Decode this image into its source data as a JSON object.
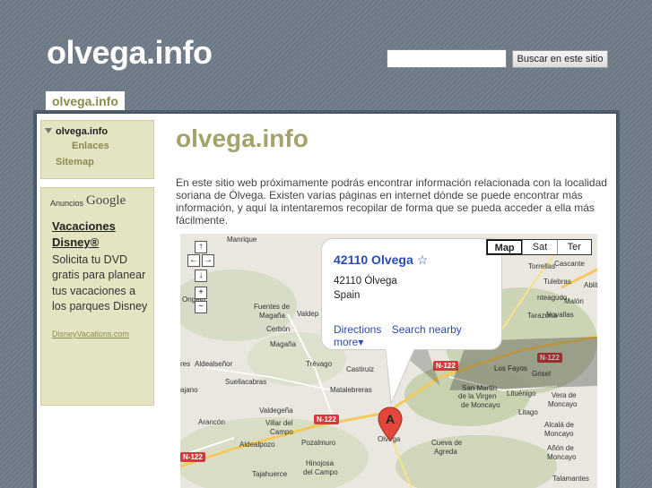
{
  "header": {
    "site_title": "olvega.info",
    "search_placeholder": "",
    "search_button": "Buscar en este sitio"
  },
  "tab": {
    "label": "olvega.info"
  },
  "sidebar": {
    "nav": [
      {
        "label": "olvega.info",
        "active": true
      },
      {
        "label": "Enlaces"
      },
      {
        "label": "Sitemap"
      }
    ],
    "ad": {
      "ads_label": "Anuncios",
      "google_label": "Google",
      "title": "Vacaciones Disney®",
      "body": "Solicita tu DVD gratis para planear tus vacaciones a los parques Disney",
      "url": "DisneyVacations.com"
    }
  },
  "main": {
    "title": "olvega.info",
    "intro": "En este sitio web próximamente podrás encontrar información relacionada con la localidad soriana de Ólvega. Existen varias páginas en internet dónde se puede encontrar más información, y aquí la intentaremos recopilar de forma que se pueda acceder a ella más fácilmente."
  },
  "map": {
    "type_buttons": [
      "Map",
      "Sat",
      "Ter"
    ],
    "info_window": {
      "title": "42110 Olvega",
      "line1": "42110 Ólvega",
      "line2": "Spain",
      "links": [
        "Directions",
        "Search nearby",
        "more▾"
      ]
    },
    "marker_label": "A",
    "places": [
      {
        "name": "Manrique"
      },
      {
        "name": "Fuentes de"
      },
      {
        "name": "Magaña"
      },
      {
        "name": "Valdep"
      },
      {
        "name": "Cerbón"
      },
      {
        "name": "Magaña"
      },
      {
        "name": "Aldealseñor"
      },
      {
        "name": "Suellacabras"
      },
      {
        "name": "Trévago"
      },
      {
        "name": "Castiruiz"
      },
      {
        "name": "Matalebreras"
      },
      {
        "name": "Valdegeña"
      },
      {
        "name": "Arancón"
      },
      {
        "name": "Villar del"
      },
      {
        "name": "Campo"
      },
      {
        "name": "Aldealpozo"
      },
      {
        "name": "Pozalmuro"
      },
      {
        "name": "Hinojosa"
      },
      {
        "name": "del Campo"
      },
      {
        "name": "Tajahuerce"
      },
      {
        "name": "Olvega"
      },
      {
        "name": "Cueva de"
      },
      {
        "name": "Agreda"
      },
      {
        "name": "San Martín"
      },
      {
        "name": "de la Virgen"
      },
      {
        "name": "de Moncayo"
      },
      {
        "name": "Litago"
      },
      {
        "name": "Lituénigo"
      },
      {
        "name": "Vera de"
      },
      {
        "name": "Moncayo"
      },
      {
        "name": "Alcalá de"
      },
      {
        "name": "Moncayo"
      },
      {
        "name": "Añón de"
      },
      {
        "name": "Moncayo"
      },
      {
        "name": "Talamantes"
      },
      {
        "name": "Tarazona"
      },
      {
        "name": "Los Fayos"
      },
      {
        "name": "Grisel"
      },
      {
        "name": "Torrellas"
      },
      {
        "name": "Novallas"
      },
      {
        "name": "Malón"
      },
      {
        "name": "nteagudo"
      },
      {
        "name": "Tulebras"
      },
      {
        "name": "Ablit"
      },
      {
        "name": "Cascante"
      },
      {
        "name": "Ongelo"
      },
      {
        "name": "res"
      },
      {
        "name": "ajano"
      }
    ],
    "roads": [
      "N-122",
      "N-122",
      "N-122",
      "N-122"
    ]
  }
}
